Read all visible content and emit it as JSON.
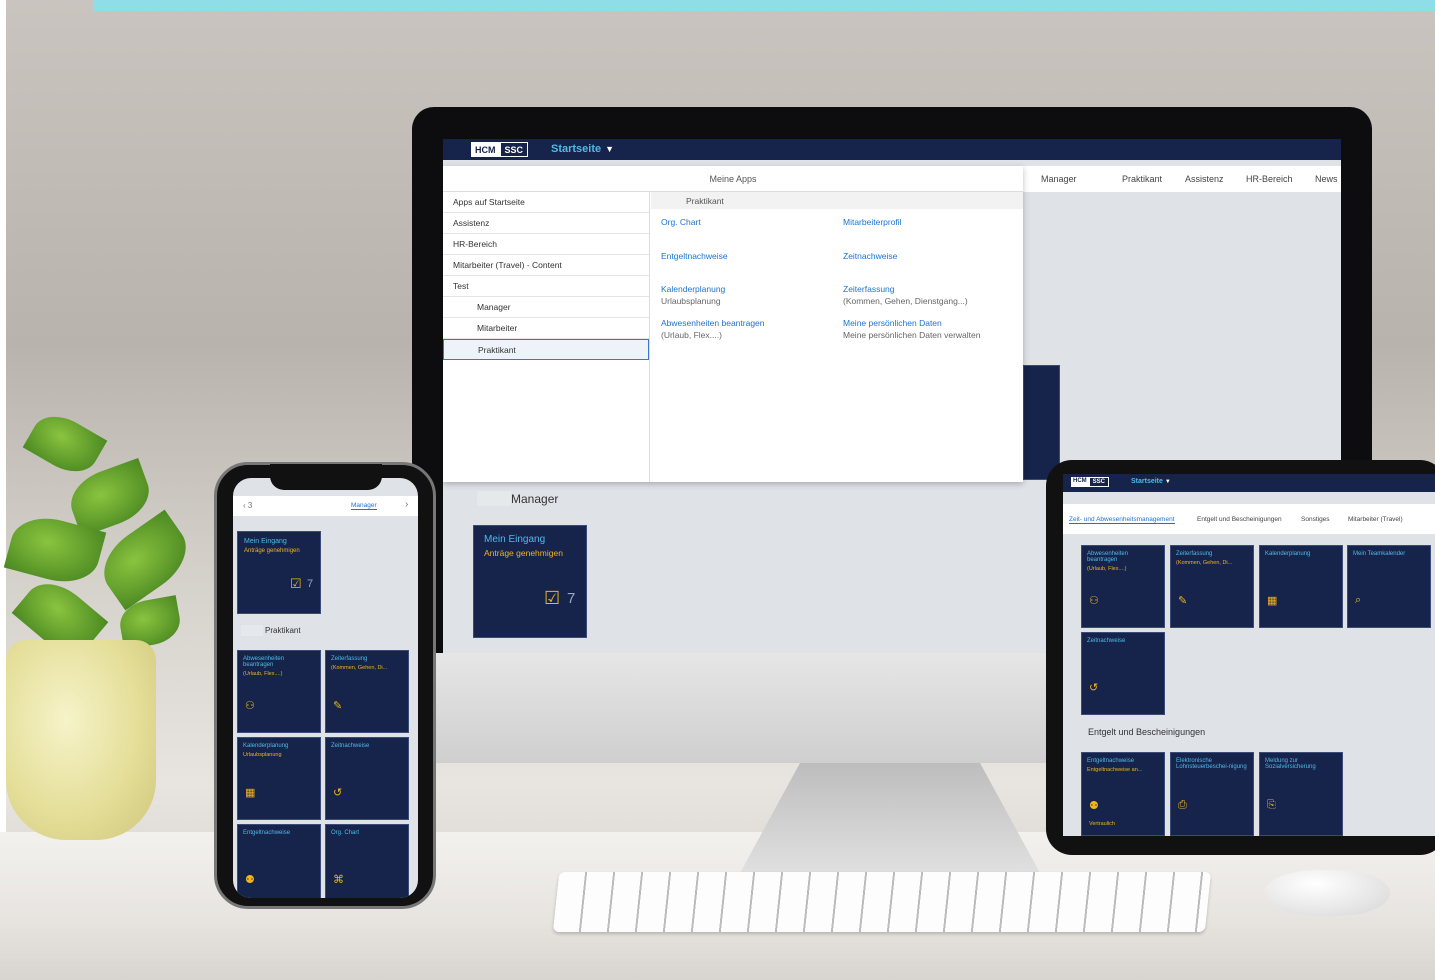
{
  "monitor": {
    "shell": {
      "logo_left": "HCM",
      "logo_right": "SSC",
      "title": "Startseite",
      "caret": "▼"
    },
    "tabs": [
      "Manager",
      "Praktikant",
      "Assistenz",
      "HR-Bereich",
      "News"
    ],
    "menu": {
      "header": "Meine Apps",
      "groups": [
        {
          "label": "Apps auf Startseite",
          "sub": false,
          "selected": false
        },
        {
          "label": "Assistenz",
          "sub": false,
          "selected": false
        },
        {
          "label": "HR-Bereich",
          "sub": false,
          "selected": false
        },
        {
          "label": "Mitarbeiter (Travel) - Content",
          "sub": false,
          "selected": false
        },
        {
          "label": "Test",
          "sub": false,
          "selected": false
        },
        {
          "label": "Manager",
          "sub": true,
          "selected": false
        },
        {
          "label": "Mitarbeiter",
          "sub": true,
          "selected": false
        },
        {
          "label": "Praktikant",
          "sub": true,
          "selected": true
        }
      ],
      "group_header": "Praktikant",
      "apps": [
        {
          "title": "Org. Chart",
          "subtitle": ""
        },
        {
          "title": "Mitarbeiterprofil",
          "subtitle": ""
        },
        {
          "title": "Entgeltnachweise",
          "subtitle": ""
        },
        {
          "title": "Zeitnachweise",
          "subtitle": ""
        },
        {
          "title": "Kalenderplanung",
          "subtitle": "Urlaubsplanung"
        },
        {
          "title": "Zeiterfassung",
          "subtitle": "(Kommen, Gehen, Dienstgang...)"
        },
        {
          "title": "Abwesenheiten beantragen",
          "subtitle": "(Urlaub, Flex....)"
        },
        {
          "title": "Meine persönlichen Daten",
          "subtitle": "Meine persönlichen Daten verwalten"
        }
      ]
    },
    "section_title": "Manager",
    "tile": {
      "title": "Mein Eingang",
      "subtitle": "Anträge genehmigen",
      "count": "7",
      "icon": "checkbox-icon"
    }
  },
  "phone": {
    "nav_left": "‹ 3",
    "nav_tab": "Manager",
    "nav_right": "›",
    "tile_inbox": {
      "title": "Mein Eingang",
      "subtitle": "Anträge genehmigen",
      "count": "7"
    },
    "section_title": "Praktikant",
    "tiles": [
      {
        "title": "Abwesenheiten beantragen",
        "subtitle": "(Urlaub, Flex....)",
        "icon": "person-add-icon"
      },
      {
        "title": "Zeiterfassung",
        "subtitle": "(Kommen, Gehen, Di...",
        "icon": "edit-icon"
      },
      {
        "title": "Kalenderplanung",
        "subtitle": "Urlaubsplanung",
        "icon": "calendar-icon"
      },
      {
        "title": "Zeitnachweise",
        "subtitle": "",
        "icon": "history-icon"
      },
      {
        "title": "Entgeltnachweise",
        "subtitle": "",
        "icon": "payroll-icon"
      },
      {
        "title": "Org. Chart",
        "subtitle": "",
        "icon": "org-chart-icon"
      }
    ]
  },
  "tablet": {
    "shell": {
      "logo_left": "HCM",
      "logo_right": "SSC",
      "title": "Startseite",
      "caret": "▼"
    },
    "tabs": [
      "Zeit- und Abwesenheitsmanagement",
      "Entgelt und Bescheinigungen",
      "Sonstiges",
      "Mitarbeiter (Travel)"
    ],
    "tiles_row1": [
      {
        "title": "Abwesenheiten beantragen",
        "subtitle": "(Urlaub, Flex....)",
        "icon": "person-add-icon"
      },
      {
        "title": "Zeiterfassung",
        "subtitle": "(Kommen, Gehen, Di...",
        "icon": "edit-icon"
      },
      {
        "title": "Kalenderplanung",
        "subtitle": "",
        "icon": "calendar-icon"
      },
      {
        "title": "Mein Teamkalender",
        "subtitle": "",
        "icon": "calendar-search-icon"
      }
    ],
    "tile_row2": {
      "title": "Zeitnachweise",
      "icon": "history-icon"
    },
    "section_title": "Entgelt und Bescheinigungen",
    "tiles_row3": [
      {
        "title": "Entgeltnachweise",
        "subtitle": "Entgeltnachweise an...",
        "footer": "Vertraulich",
        "icon": "payroll-icon"
      },
      {
        "title": "Elektronische Lohnsteuerbeschei-nigung",
        "subtitle": "",
        "footer": "",
        "icon": "document-money-icon"
      },
      {
        "title": "Meldung zur Sozialversicherung",
        "subtitle": "",
        "footer": "",
        "icon": "document-insurance-icon"
      }
    ]
  },
  "colors": {
    "shell": "#16234a",
    "tile": "#16234a",
    "tile_title": "#4dbbe8",
    "tile_subtitle": "#f0b41c",
    "link": "#1b73d1",
    "accent_strip": "#8fdde6"
  }
}
